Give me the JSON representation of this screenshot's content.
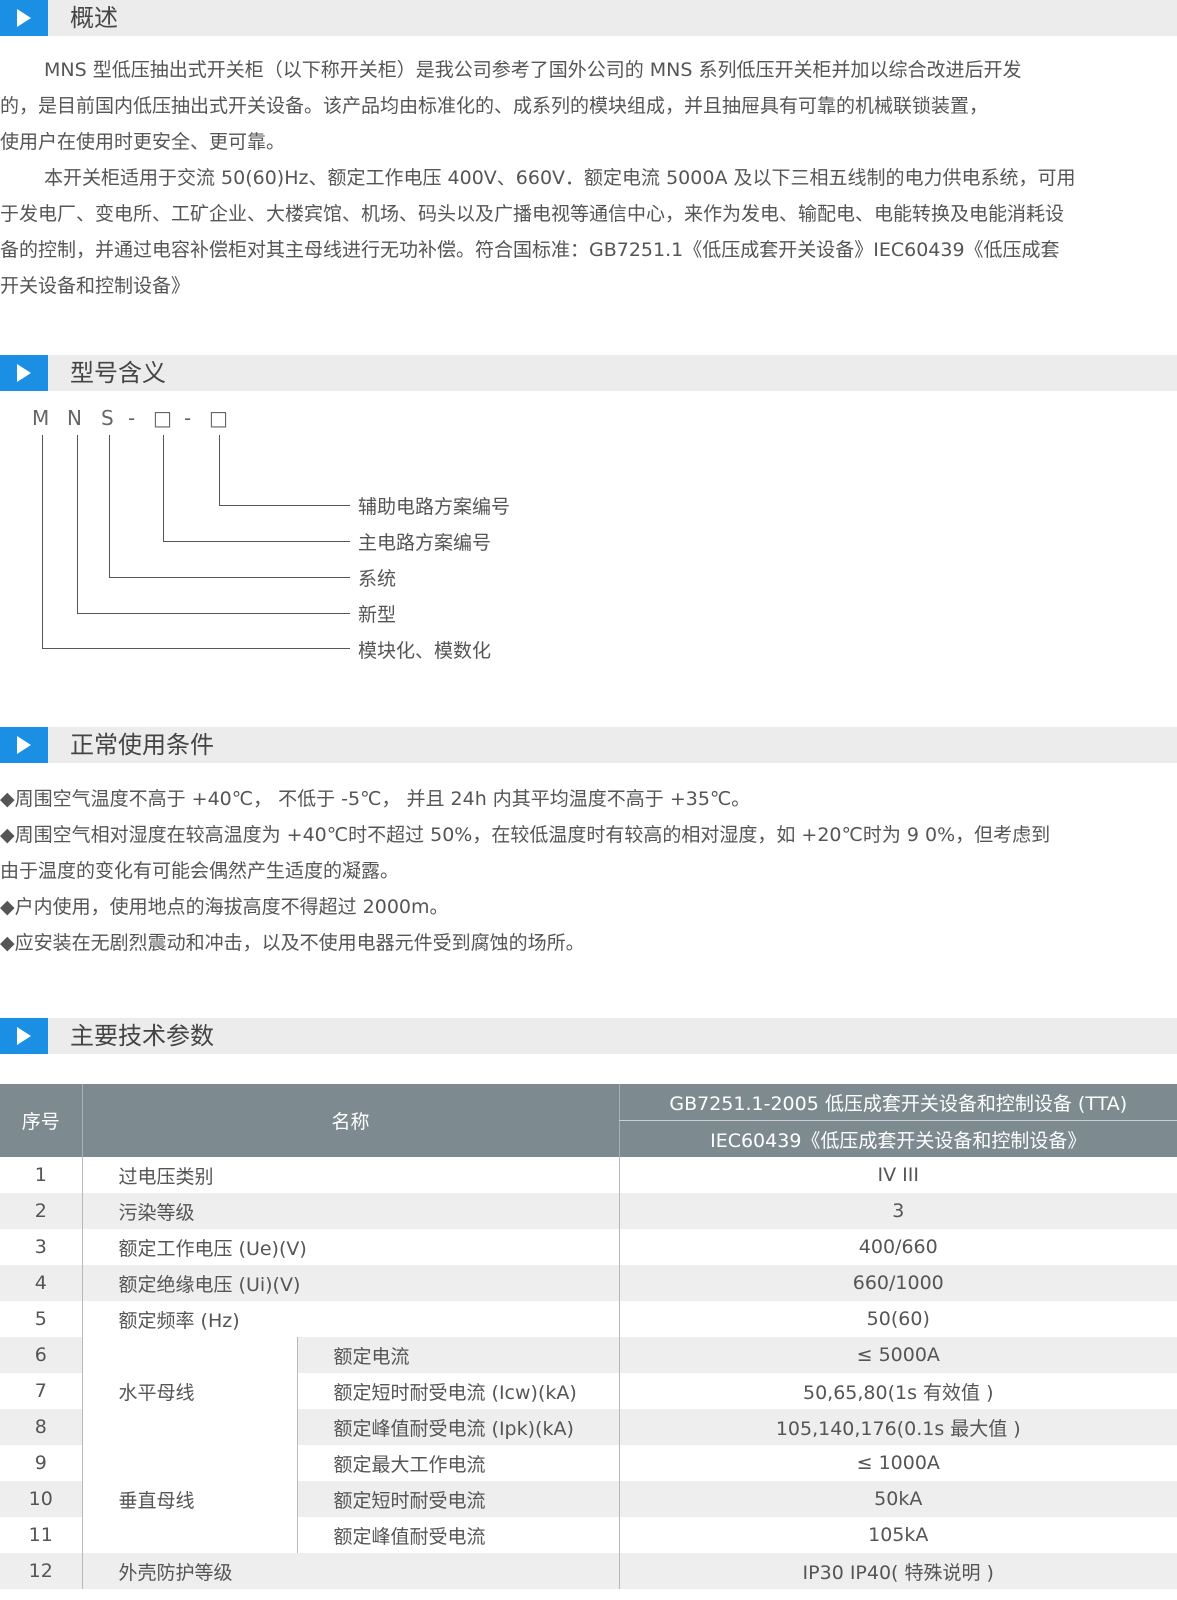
{
  "sections": {
    "overview": {
      "title": "概述",
      "para1": [
        "MNS 型低压抽出式开关柜（以下称开关柜）是我公司参考了国外公司的 MNS 系列低压开关柜并加以综合改进后开发",
        "的，是目前国内低压抽出式开关设备。该产品均由标准化的、成系列的模块组成，并且抽屉具有可靠的机械联锁装置，",
        "使用户在使用时更安全、更可靠。"
      ],
      "para2": [
        "本开关柜适用于交流 50(60)Hz、额定工作电压 400V、660V．额定电流 5000A 及以下三相五线制的电力供电系统，可用",
        "于发电厂、变电所、工矿企业、大楼宾馆、机场、码头以及广播电视等通信中心，来作为发电、输配电、电能转换及电能消耗设",
        "备的控制，并通过电容补偿柜对其主母线进行无功补偿。符合国标准：GB7251.1《低压成套开关设备》IEC60439《低压成套",
        "开关设备和控制设备》"
      ]
    },
    "model": {
      "title": "型号含义",
      "code_chars": [
        "M",
        "N",
        "S",
        "-",
        "□",
        "-",
        "□"
      ],
      "labels": [
        "辅助电路方案编号",
        "主电路方案编号",
        "系统",
        "新型",
        "模块化、模数化"
      ]
    },
    "conditions": {
      "title": "正常使用条件",
      "items": [
        "◆周围空气温度不高于 +40℃， 不低于 -5℃， 并且 24h 内其平均温度不高于 +35℃。",
        "◆周围空气相对湿度在较高温度为 +40℃时不超过 50%，在较低温度时有较高的相对湿度，如 +20℃时为 9 0%，但考虑到",
        "由于温度的变化有可能会偶然产生适度的凝露。",
        "◆户内使用，使用地点的海拔高度不得超过 2000m。",
        "◆应安装在无剧烈震动和冲击，以及不使用电器元件受到腐蚀的场所。"
      ]
    },
    "specs": {
      "title": "主要技术参数",
      "header": {
        "no": "序号",
        "name": "名称",
        "std1": "GB7251.1-2005 低压成套开关设备和控制设备 (TTA)",
        "std2": "IEC60439《低压成套开关设备和控制设备》"
      },
      "groups": {
        "horizontal": "水平母线",
        "vertical": "垂直母线"
      },
      "rows": [
        {
          "no": "1",
          "name": "过电压类别",
          "value": "IV III"
        },
        {
          "no": "2",
          "name": "污染等级",
          "value": "3"
        },
        {
          "no": "3",
          "name": "额定工作电压 (Ue)(V)",
          "value": "400/660"
        },
        {
          "no": "4",
          "name": "额定绝缘电压 (Ui)(V)",
          "value": "660/1000"
        },
        {
          "no": "5",
          "name": "额定频率 (Hz)",
          "value": "50(60)"
        },
        {
          "no": "6",
          "name": "额定电流",
          "value": "≤ 5000A"
        },
        {
          "no": "7",
          "name": "额定短时耐受电流 (Icw)(kA)",
          "value": "50,65,80(1s 有效值 )"
        },
        {
          "no": "8",
          "name": "额定峰值耐受电流 (Ipk)(kA)",
          "value": "105,140,176(0.1s 最大值 )"
        },
        {
          "no": "9",
          "name": "额定最大工作电流",
          "value": "≤ 1000A"
        },
        {
          "no": "10",
          "name": "额定短时耐受电流",
          "value": "50kA"
        },
        {
          "no": "11",
          "name": "额定峰值耐受电流",
          "value": "105kA"
        },
        {
          "no": "12",
          "name": "外壳防护等级",
          "value": "IP30 IP40( 特殊说明 )"
        }
      ]
    }
  },
  "colors": {
    "accent": "#1a8fe3",
    "header_bg": "#7d8b91",
    "stripe": "#eeeeee",
    "section_bar": "#ececec"
  }
}
